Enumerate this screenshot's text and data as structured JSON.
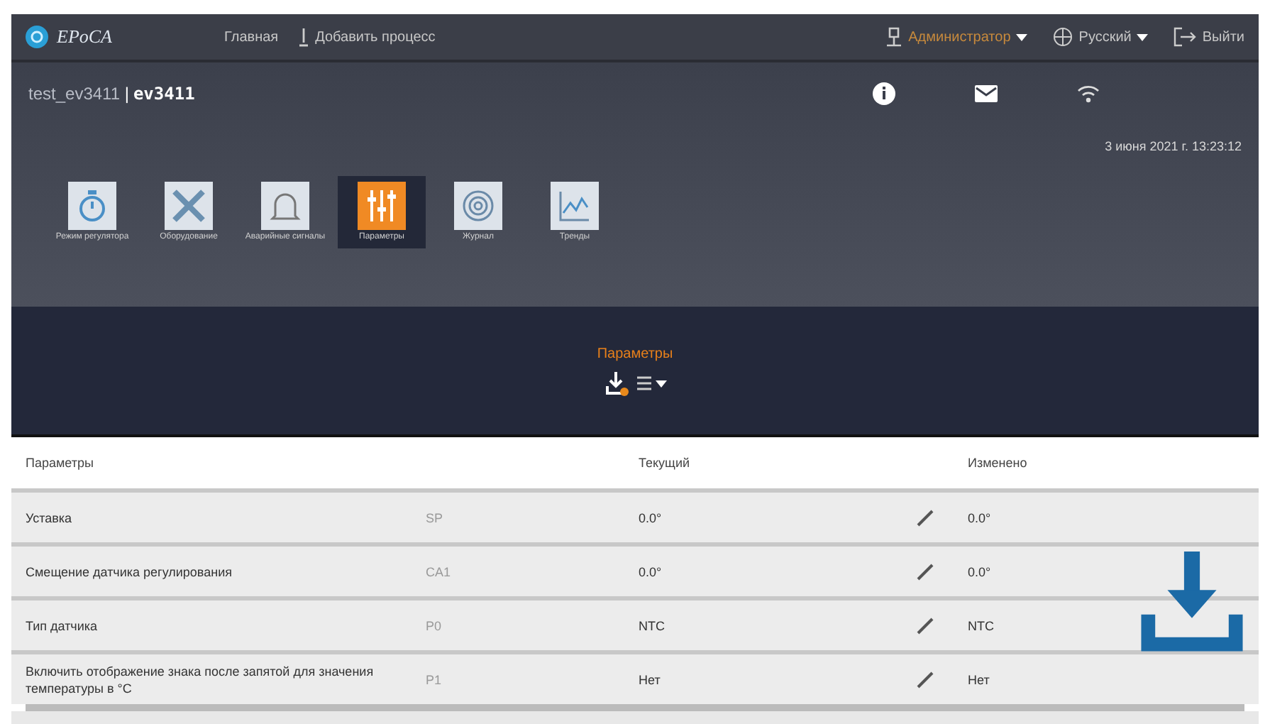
{
  "topbar": {
    "logo": "EPoCA",
    "nav": [
      "Главная",
      "Добавить процесс"
    ],
    "user": "Администратор",
    "language": "Русский",
    "logout": "Выйти"
  },
  "device": {
    "name": "test_ev3411",
    "separator": "|",
    "model": "ev3411",
    "datetime": "3 июня 2021 г. 13:23:12"
  },
  "modules": [
    {
      "label": "Режим регулятора",
      "kind": "timer",
      "selected": false
    },
    {
      "label": "Оборудование",
      "kind": "tools",
      "selected": false
    },
    {
      "label": "Аварийные сигналы",
      "kind": "bell",
      "selected": false
    },
    {
      "label": "Параметры",
      "kind": "sliders",
      "selected": true
    },
    {
      "label": "Журнал",
      "kind": "spiral",
      "selected": false
    },
    {
      "label": "Тренды",
      "kind": "chart",
      "selected": false
    }
  ],
  "section": {
    "title": "Параметры"
  },
  "table": {
    "columns": [
      "Параметры",
      "Текущий",
      "Изменено"
    ],
    "rows": [
      {
        "name": "Уставка",
        "code": "SP",
        "current": "0.0°",
        "changed": "0.0°"
      },
      {
        "name": "Смещение датчика регулирования",
        "code": "CA1",
        "current": "0.0°",
        "changed": "0.0°"
      },
      {
        "name": "Тип датчика",
        "code": "P0",
        "current": "NTC",
        "changed": "NTC"
      },
      {
        "name": "Включить отображение знака после запятой для значения температуры в °С",
        "code": "P1",
        "current": "Нет",
        "changed": "Нет"
      }
    ]
  }
}
